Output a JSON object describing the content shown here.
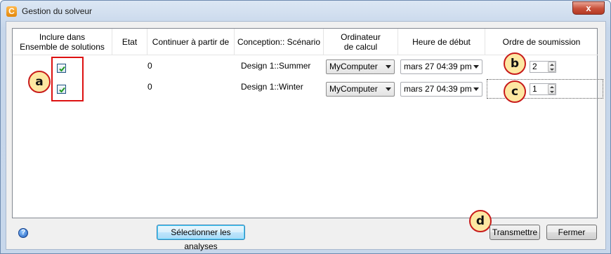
{
  "window": {
    "title": "Gestion du solveur",
    "app_icon_glyph": "C",
    "close_glyph": "x"
  },
  "table": {
    "headers": {
      "include_line1": "Inclure dans",
      "include_line2": "Ensemble de solutions",
      "state": "Etat",
      "continue_from": "Continuer à partir de",
      "scenario": "Conception:: Scénario",
      "computer_line1": "Ordinateur",
      "computer_line2": "de calcul",
      "start_time": "Heure de début",
      "order": "Ordre de soumission"
    },
    "rows": [
      {
        "included": true,
        "state": "",
        "continue_from": "0",
        "scenario": "Design 1::Summer",
        "computer": "MyComputer",
        "start_time": "mars 27 04:39 pm",
        "order": "2"
      },
      {
        "included": true,
        "state": "",
        "continue_from": "0",
        "scenario": "Design 1::Winter",
        "computer": "MyComputer",
        "start_time": "mars 27 04:39 pm",
        "order": "1"
      }
    ]
  },
  "annotations": {
    "a": "a",
    "b": "b",
    "c": "c",
    "d": "d"
  },
  "footer": {
    "help_glyph": "?",
    "select_analyses": "Sélectionner les analyses",
    "submit": "Transmettre",
    "close": "Fermer"
  }
}
